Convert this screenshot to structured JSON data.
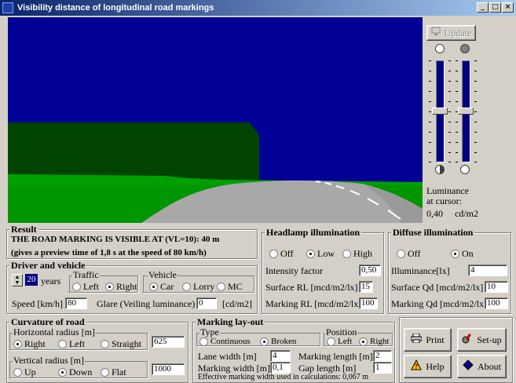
{
  "window": {
    "title": "Visibility distance of longitudinal road markings",
    "minimize": "_",
    "maximize": "□",
    "close": "×"
  },
  "side_panel": {
    "update_label": "Update",
    "luminance_label_1": "Luminance",
    "luminance_label_2": "at cursor:",
    "luminance_value": "0,40",
    "luminance_unit": "cd/m2"
  },
  "result": {
    "legend": "Result",
    "line1": "THE ROAD MARKING IS VISIBLE AT (VL=10):  40  m",
    "line2": "(gives a preview time of 1,8 s at the speed of 80  km/h)"
  },
  "headlamp": {
    "legend": "Headlamp illumination",
    "options": [
      "Off",
      "Low",
      "High"
    ],
    "selected": "Low",
    "intensity_label": "Intensity factor",
    "intensity_value": "0,50",
    "surface_rl_label": "Surface RL [mcd/m2/lx]",
    "surface_rl_value": "15",
    "marking_rl_label": "Marking RL [mcd/m2/lx]",
    "marking_rl_value": "100"
  },
  "diffuse": {
    "legend": "Diffuse illumination",
    "options": [
      "Off",
      "On"
    ],
    "selected": "On",
    "illuminance_label": "Illuminance[lx]",
    "illuminance_value": "4",
    "surface_qd_label": "Surface Qd [mcd/m2/lx]",
    "surface_qd_value": "10",
    "marking_qd_label": "Marking Qd [mcd/m2/lx]",
    "marking_qd_value": "100"
  },
  "driver": {
    "legend": "Driver and vehicle",
    "age_value": "20",
    "age_unit": "years",
    "traffic_legend": "Traffic",
    "traffic_options": [
      "Left",
      "Right"
    ],
    "traffic_selected": "Right",
    "vehicle_legend": "Vehicle",
    "vehicle_options": [
      "Car",
      "Lorry",
      "MC"
    ],
    "vehicle_selected": "Car",
    "speed_label": "Speed [km/h]",
    "speed_value": "80",
    "glare_label": "Glare (Veiling luminance)",
    "glare_value": "0",
    "glare_unit": "[cd/m2]"
  },
  "curvature": {
    "legend": "Curvature of road",
    "horizontal_legend": "Horizontal radius [m]",
    "horizontal_options": [
      "Right",
      "Left",
      "Straight"
    ],
    "horizontal_selected": "Right",
    "horizontal_value": "625",
    "vertical_legend": "Vertical radius [m]",
    "vertical_options": [
      "Up",
      "Down",
      "Flat"
    ],
    "vertical_selected": "Down",
    "vertical_value": "1000"
  },
  "marking": {
    "legend": "Marking lay-out",
    "type_legend": "Type",
    "type_options": [
      "Continuous",
      "Broken"
    ],
    "type_selected": "Broken",
    "position_legend": "Position",
    "position_options": [
      "Left",
      "Right"
    ],
    "position_selected": "Right",
    "lane_width_label": "Lane width [m]",
    "lane_width_value": "4",
    "marking_length_label": "Marking length [m]",
    "marking_length_value": "2",
    "marking_width_label": "Marking width [m]",
    "marking_width_value": "0,1",
    "gap_length_label": "Gap length [m]",
    "gap_length_value": "1",
    "effective_note": "Effective marking width used in calculations: 0,067 m"
  },
  "buttons": {
    "print": "Print",
    "setup": "Set-up",
    "help": "Help",
    "about": "About"
  },
  "colors": {
    "sky": "#000096",
    "grass": "#009600",
    "road": "#a0a0a0",
    "slider_track": "#000080",
    "titlebar": "#0a246a"
  }
}
